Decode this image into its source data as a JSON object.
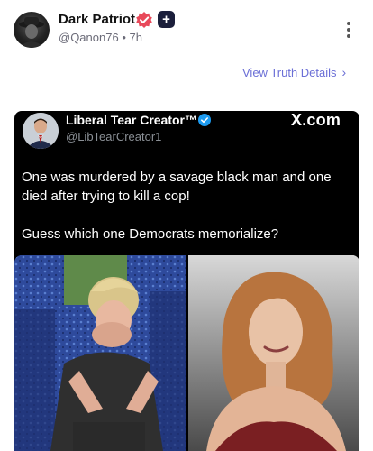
{
  "post": {
    "display_name": "Dark Patriot",
    "handle": "@Qanon76",
    "separator": "•",
    "time_ago": "7h",
    "view_details_label": "View Truth Details",
    "chevron": "›"
  },
  "embedded_tweet": {
    "display_name": "Liberal Tear Creator™",
    "handle": "@LibTearCreator1",
    "platform_logo": "X.com",
    "paragraphs": [
      "One was murdered by a savage black man and one died after trying to kill a cop!",
      "Guess which one Democrats memorialize?"
    ]
  },
  "icons": {
    "verified": "verified-badge-icon",
    "plus": "plus-badge-icon",
    "menu": "kebab-menu-icon",
    "x_logo": "x-logo-icon"
  },
  "colors": {
    "link": "#6b6fd6",
    "verified_badge": "#e8495a",
    "embed_bg": "#000000",
    "embed_verified": "#1d9bf0"
  }
}
